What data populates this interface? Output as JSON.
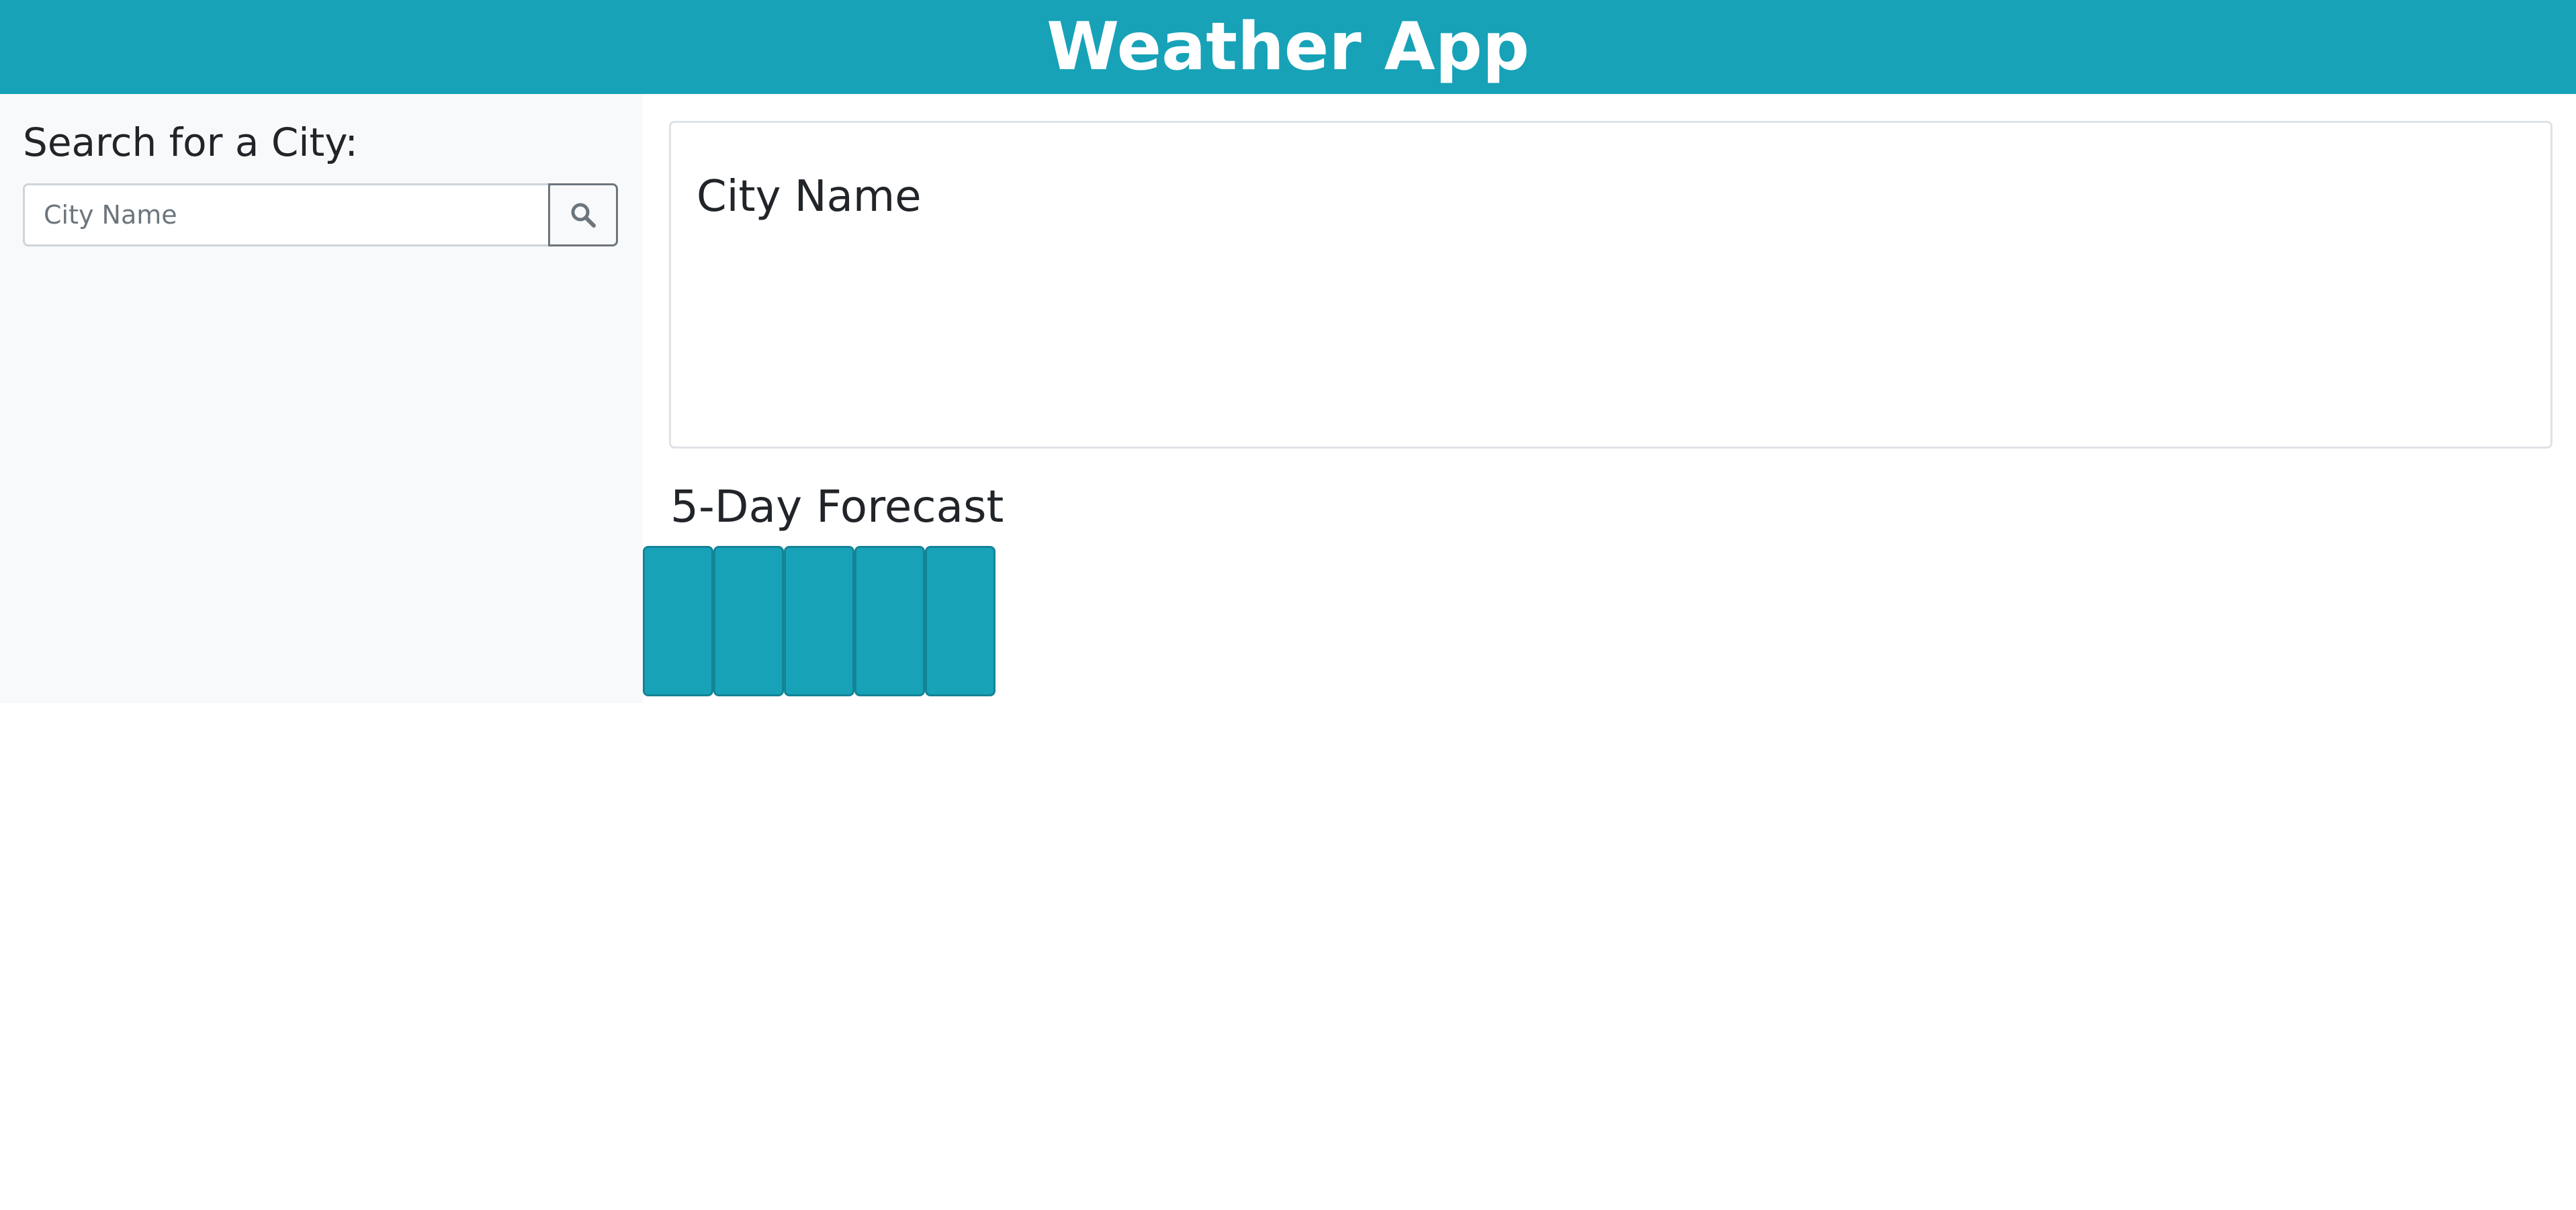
{
  "header": {
    "title": "Weather App"
  },
  "sidebar": {
    "search_label": "Search for a City:",
    "search_placeholder": "City Name",
    "search_value": "",
    "search_button_icon": "search-icon"
  },
  "main": {
    "current_city": {
      "name": "City Name"
    },
    "forecast": {
      "title": "5-Day Forecast",
      "days": [
        {
          "label": ""
        },
        {
          "label": ""
        },
        {
          "label": ""
        },
        {
          "label": ""
        },
        {
          "label": ""
        }
      ]
    }
  },
  "colors": {
    "accent": "#17a2b8",
    "sidebar_bg": "#f8f9fa",
    "text": "#212529"
  }
}
